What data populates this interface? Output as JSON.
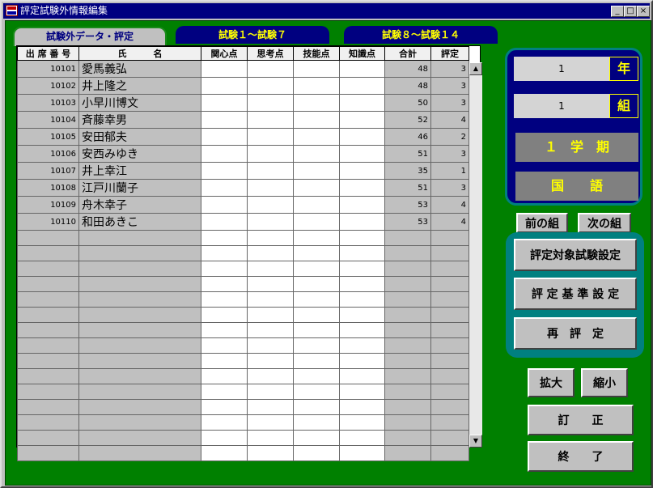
{
  "window": {
    "title": "評定試験外情報編集",
    "min": "_",
    "max": "□",
    "close": "×"
  },
  "tabs": [
    {
      "label": "試験外データ・評定"
    },
    {
      "label": "試験１～試験７"
    },
    {
      "label": "試験８～試験１４"
    }
  ],
  "grid": {
    "headers": [
      "出 席 番 号",
      "氏　　　名",
      "関心点",
      "思考点",
      "技能点",
      "知識点",
      "合計",
      "評定"
    ],
    "rows": [
      {
        "no": "10101",
        "name": "愛馬義弘",
        "total": "48",
        "grade": "3"
      },
      {
        "no": "10102",
        "name": "井上隆之",
        "total": "48",
        "grade": "3"
      },
      {
        "no": "10103",
        "name": "小早川博文",
        "total": "50",
        "grade": "3"
      },
      {
        "no": "10104",
        "name": "斉藤幸男",
        "total": "52",
        "grade": "4"
      },
      {
        "no": "10105",
        "name": "安田郁夫",
        "total": "46",
        "grade": "2"
      },
      {
        "no": "10106",
        "name": "安西みゆき",
        "total": "51",
        "grade": "3"
      },
      {
        "no": "10107",
        "name": "井上幸江",
        "total": "35",
        "grade": "1"
      },
      {
        "no": "10108",
        "name": "江戸川蘭子",
        "total": "51",
        "grade": "3"
      },
      {
        "no": "10109",
        "name": "舟木幸子",
        "total": "53",
        "grade": "4"
      },
      {
        "no": "10110",
        "name": "和田あきこ",
        "total": "53",
        "grade": "4"
      }
    ],
    "empty_rows": 15
  },
  "side": {
    "year_value": "1",
    "year_label": "年",
    "class_value": "1",
    "class_label": "組",
    "term": "１　学　期",
    "subject": "国　　語"
  },
  "buttons": {
    "prev": "前の組",
    "next": "次の組",
    "target": "評定対象試験設定",
    "criteria": "評 定 基 準 設 定",
    "reeval": "再　評　定",
    "zoom_in": "拡大",
    "zoom_out": "縮小",
    "correct": "訂　　正",
    "end": "終　　了"
  },
  "scroll": {
    "up": "▲",
    "down": "▼"
  }
}
